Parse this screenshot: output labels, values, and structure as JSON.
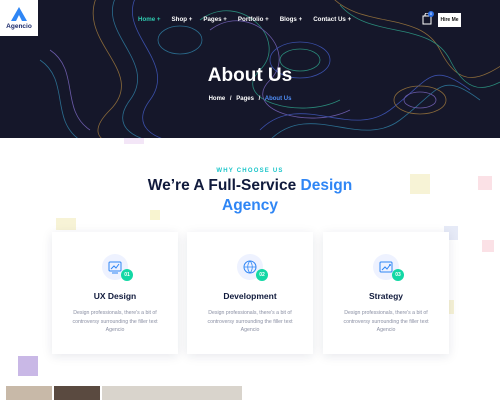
{
  "header": {
    "logo_text": "Agencio",
    "nav": [
      {
        "label": "Home +",
        "active": true
      },
      {
        "label": "Shop +",
        "active": false
      },
      {
        "label": "Pages +",
        "active": false
      },
      {
        "label": "Portfolio +",
        "active": false
      },
      {
        "label": "Blogs +",
        "active": false
      },
      {
        "label": "Contact Us +",
        "active": false
      }
    ],
    "cart_icon": "bag-icon",
    "cart_count": "0",
    "hire_label": "Hire Me"
  },
  "hero": {
    "title": "About Us",
    "breadcrumb": {
      "home": "Home",
      "pages": "Pages",
      "separator": "/",
      "current": "About Us"
    }
  },
  "section": {
    "eyebrow": "WHY CHOOSE US",
    "headline_part1": "We’re A Full-Service",
    "headline_accent": "Design",
    "headline_part2": "Agency"
  },
  "cards": [
    {
      "icon": "ux-design-icon",
      "number": "01",
      "title": "UX Design",
      "text": "Design professionals, there's a bit of controversy surrounding the filler text Agencio"
    },
    {
      "icon": "development-icon",
      "number": "02",
      "title": "Development",
      "text": "Design professionals, there's a bit of controversy surrounding the filler text Agencio"
    },
    {
      "icon": "strategy-icon",
      "number": "03",
      "title": "Strategy",
      "text": "Design professionals, there's a bit of controversy surrounding the filler text Agencio"
    }
  ],
  "colors": {
    "hero_bg": "#15172a",
    "accent_teal": "#2ecbb0",
    "accent_blue": "#2f86f5",
    "heading": "#101a3c",
    "badge_green": "#13d8a5"
  }
}
